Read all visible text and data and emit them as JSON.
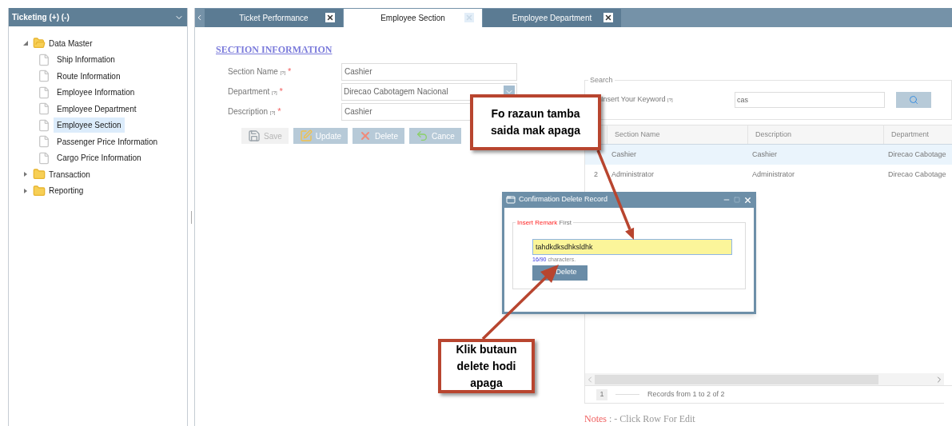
{
  "sidebar": {
    "title": "Ticketing (+) (-)",
    "tree": [
      {
        "label": "Data Master",
        "expanded": true,
        "children": [
          {
            "label": "Ship Information",
            "selected": false
          },
          {
            "label": "Route Information",
            "selected": false
          },
          {
            "label": "Employee Information",
            "selected": false
          },
          {
            "label": "Employee Department",
            "selected": false
          },
          {
            "label": "Employee Section",
            "selected": true
          },
          {
            "label": "Passenger Price Information",
            "selected": false
          },
          {
            "label": "Cargo Price Information",
            "selected": false
          }
        ]
      },
      {
        "label": "Transaction",
        "expanded": false
      },
      {
        "label": "Reporting",
        "expanded": false
      }
    ]
  },
  "tabs": [
    {
      "label": "Ticket Performance",
      "selected": false
    },
    {
      "label": "Employee Section",
      "selected": true
    },
    {
      "label": "Employee Department",
      "selected": false
    }
  ],
  "form": {
    "heading": "SECTION INFORMATION",
    "fields": [
      {
        "label": "Section Name",
        "hint": "[?]",
        "required": "*",
        "value": "Cashier",
        "kind": "text"
      },
      {
        "label": "Department",
        "hint": "[?]",
        "required": "*",
        "value": "Direcao Cabotagem Nacional",
        "kind": "select"
      },
      {
        "label": "Description",
        "hint": "[?]",
        "required": "*",
        "value": "Cashier",
        "kind": "text"
      }
    ],
    "buttons": [
      {
        "label": "Save",
        "kind": "save",
        "disabled": true
      },
      {
        "label": "Update",
        "kind": "update",
        "disabled": false
      },
      {
        "label": "Delete",
        "kind": "delete",
        "disabled": false
      },
      {
        "label": "Cance",
        "kind": "cancel",
        "disabled": false
      }
    ]
  },
  "search": {
    "legend": "Search",
    "label": "Insert Your Keyword",
    "hint": "[?]",
    "value": "cas"
  },
  "table": {
    "columns": [
      "Section Name",
      "Description",
      "Department"
    ],
    "rows": [
      {
        "cells": [
          "Cashier",
          "Cashier",
          "Direcao Cabotage"
        ],
        "selected": true
      },
      {
        "number": "2",
        "cells": [
          "Administrator",
          "Administrator",
          "Direcao Cabotage"
        ],
        "selected": false
      }
    ]
  },
  "pager": {
    "page": "1",
    "text": "Records from 1 to 2 of 2"
  },
  "notes": {
    "label": "Notes",
    "text": ": - Click Row For Edit"
  },
  "dialog": {
    "title": "Confirmation Delete Record",
    "legend_highlight": "Insert Remark",
    "legend_rest": "First",
    "value": "tahdkdksdhksldhk",
    "counter": "16/90",
    "counter_text": "characters.",
    "button": "Delete"
  },
  "callouts": [
    {
      "text": "Fo razaun tamba saida mak apaga"
    },
    {
      "text": "Klik butaun delete hodi apaga"
    }
  ]
}
